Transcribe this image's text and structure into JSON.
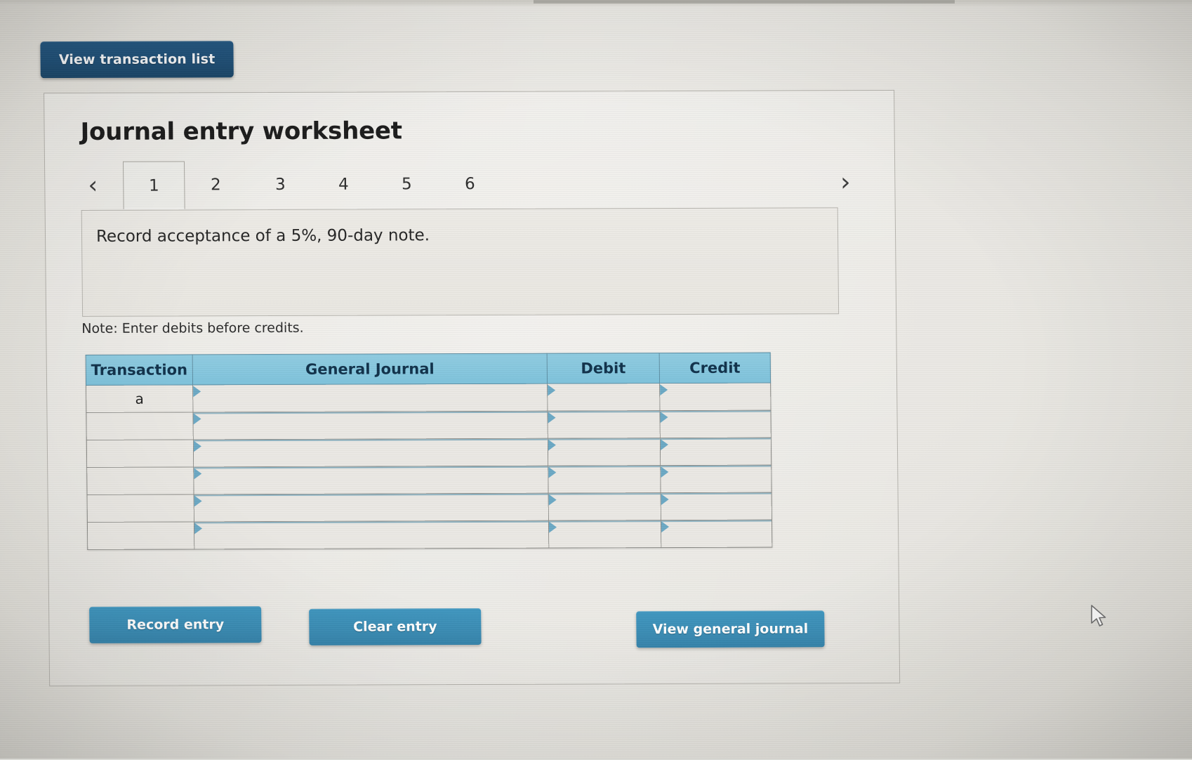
{
  "page": {
    "top_button_label": "View transaction list",
    "worksheet_title": "Journal entry worksheet",
    "instruction": "Record acceptance of a 5%, 90-day note.",
    "note": "Note: Enter debits before credits."
  },
  "tabs": {
    "prev_icon": "chevron-left-icon",
    "next_icon": "chevron-right-icon",
    "prev_glyph": "‹",
    "next_glyph": "›",
    "items": [
      {
        "label": "1",
        "active": true
      },
      {
        "label": "2",
        "active": false
      },
      {
        "label": "3",
        "active": false
      },
      {
        "label": "4",
        "active": false
      },
      {
        "label": "5",
        "active": false
      },
      {
        "label": "6",
        "active": false
      }
    ]
  },
  "table": {
    "headers": [
      "Transaction",
      "General Journal",
      "Debit",
      "Credit"
    ],
    "rows": [
      {
        "transaction": "a",
        "general_journal": "",
        "debit": "",
        "credit": ""
      },
      {
        "transaction": "",
        "general_journal": "",
        "debit": "",
        "credit": ""
      },
      {
        "transaction": "",
        "general_journal": "",
        "debit": "",
        "credit": ""
      },
      {
        "transaction": "",
        "general_journal": "",
        "debit": "",
        "credit": ""
      },
      {
        "transaction": "",
        "general_journal": "",
        "debit": "",
        "credit": ""
      },
      {
        "transaction": "",
        "general_journal": "",
        "debit": "",
        "credit": ""
      }
    ]
  },
  "actions": {
    "record_label": "Record entry",
    "clear_label": "Clear entry",
    "view_journal_label": "View general journal"
  },
  "colors": {
    "nav_button": "#1f4f76",
    "action_button": "#3a8cb4",
    "table_header": "#7ec2db",
    "page_background": "#e4e2dc"
  },
  "cursor": {
    "icon": "mouse-pointer-icon"
  }
}
